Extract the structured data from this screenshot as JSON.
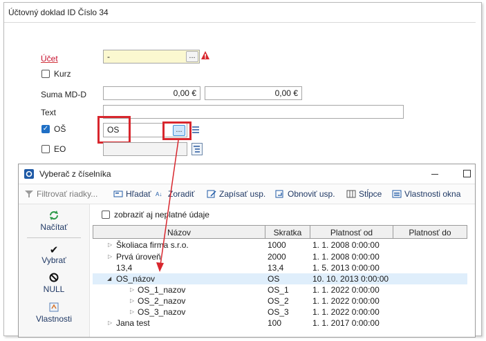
{
  "document": {
    "title": "Účtovný doklad ID Číslo 34",
    "fields": {
      "ucet_label": "Účet",
      "ucet_value": "-",
      "kurz_label": "Kurz",
      "suma_label": "Suma MD-D",
      "suma_md": "0,00 €",
      "suma_d": "0,00 €",
      "text_label": "Text",
      "text_value": "",
      "os_label": "OŠ",
      "os_value": "OS",
      "eo_label": "EO",
      "ellipsis": "..."
    }
  },
  "dialog": {
    "title": "Vyberač z číselníka",
    "toolbar": [
      {
        "label": "Filtrovať riadky...",
        "icon": "filter-icon"
      },
      {
        "label": "Hľadať",
        "icon": "search-icon"
      },
      {
        "label": "Zoradiť",
        "icon": "sort-icon"
      },
      {
        "label": "Zapísať usp.",
        "icon": "save-layout-icon"
      },
      {
        "label": "Obnoviť usp.",
        "icon": "restore-layout-icon"
      },
      {
        "label": "Stĺpce",
        "icon": "columns-icon"
      },
      {
        "label": "Vlastnosti okna",
        "icon": "window-properties-icon"
      }
    ],
    "sidebar": [
      {
        "label": "Načítať",
        "icon": "refresh-icon"
      },
      {
        "label": "Vybrať",
        "icon": "checkmark-icon"
      },
      {
        "label": "NULL",
        "icon": "null-icon"
      },
      {
        "label": "Vlastnosti",
        "icon": "properties-icon"
      }
    ],
    "show_invalid_label": "zobraziť aj neplatné údaje",
    "columns": [
      "Názov",
      "Skratka",
      "Platnosť od",
      "Platnosť do"
    ],
    "rows": [
      {
        "name": "Školiaca firma  s.r.o.",
        "code": "1000",
        "from": "1. 1. 2008 0:00:00",
        "to": "",
        "level": 0,
        "expander": "collapsed"
      },
      {
        "name": "Prvá úroveň",
        "code": "2000",
        "from": "1. 1. 2008 0:00:00",
        "to": "",
        "level": 0,
        "expander": "collapsed"
      },
      {
        "name": "13,4",
        "code": "13,4",
        "from": "1. 5. 2013 0:00:00",
        "to": "",
        "level": 0,
        "expander": "none"
      },
      {
        "name": "OS_názov",
        "code": "OS",
        "from": "10. 10. 2013 0:00:00",
        "to": "",
        "level": 0,
        "expander": "expanded",
        "selected": true
      },
      {
        "name": "OS_1_nazov",
        "code": "OS_1",
        "from": "1. 1. 2022 0:00:00",
        "to": "",
        "level": 1,
        "expander": "collapsed"
      },
      {
        "name": "OS_2_nazov",
        "code": "OS_2",
        "from": "1. 1. 2022 0:00:00",
        "to": "",
        "level": 1,
        "expander": "collapsed"
      },
      {
        "name": "OS_3_nazov",
        "code": "OS_3",
        "from": "1. 1. 2022 0:00:00",
        "to": "",
        "level": 1,
        "expander": "collapsed"
      },
      {
        "name": "Jana test",
        "code": "100",
        "from": "1. 1. 2017 0:00:00",
        "to": "",
        "level": 0,
        "expander": "collapsed"
      }
    ]
  },
  "colors": {
    "required": "#c8102e",
    "highlight": "#d8262d",
    "selected_row": "#dfeefb",
    "yellow_input": "#fbf8d0",
    "link": "#1f3864"
  }
}
